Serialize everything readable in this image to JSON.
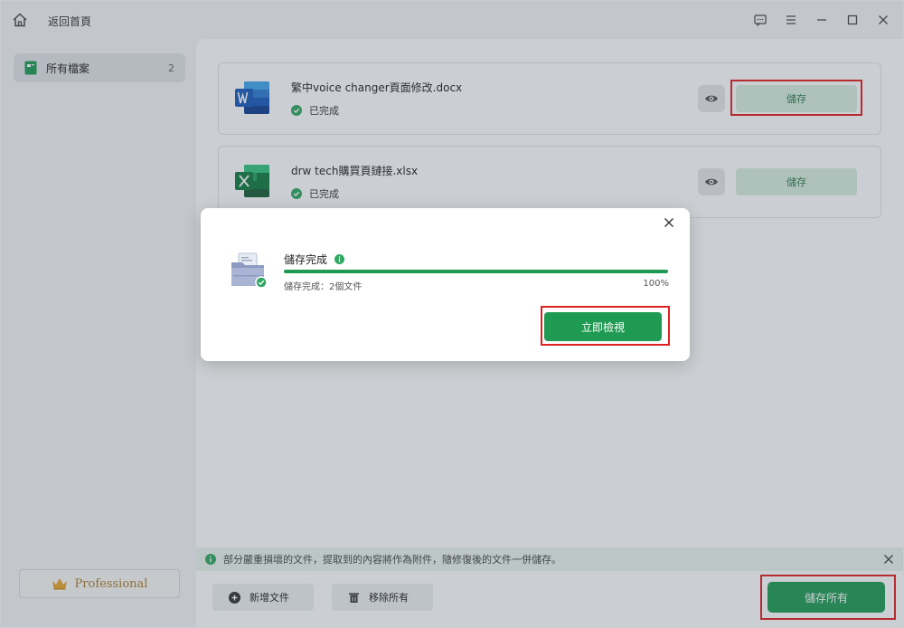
{
  "titlebar": {
    "back_label": "返回首頁",
    "icons": [
      "home-icon",
      "feedback-icon",
      "menu-icon",
      "minimize-icon",
      "maximize-icon",
      "close-icon"
    ]
  },
  "sidebar": {
    "items": [
      {
        "label": "所有檔案",
        "count": "2",
        "icon": "folder-icon"
      }
    ],
    "edition_label": "Professional"
  },
  "files": [
    {
      "name": "繁中voice changer頁面修改.docx",
      "status": "已完成",
      "type": "word",
      "save_label": "儲存"
    },
    {
      "name": "drw tech購買頁鏈接.xlsx",
      "status": "已完成",
      "type": "excel",
      "save_label": "儲存"
    }
  ],
  "notice": {
    "text": "部分嚴重損壞的文件，提取到的內容將作為附件，隨修復後的文件一併儲存。"
  },
  "bottom": {
    "add_label": "新增文件",
    "remove_label": "移除所有",
    "save_all_label": "儲存所有"
  },
  "modal": {
    "title": "儲存完成",
    "subtitle": "儲存完成：2個文件",
    "percent_text": "100%",
    "progress": 1.0,
    "view_label": "立即檢視"
  },
  "colors": {
    "accent": "#1e9a52",
    "highlight": "#e02020",
    "save_button_bg": "#d7efe0",
    "notice_bg": "#eaf4ee"
  }
}
